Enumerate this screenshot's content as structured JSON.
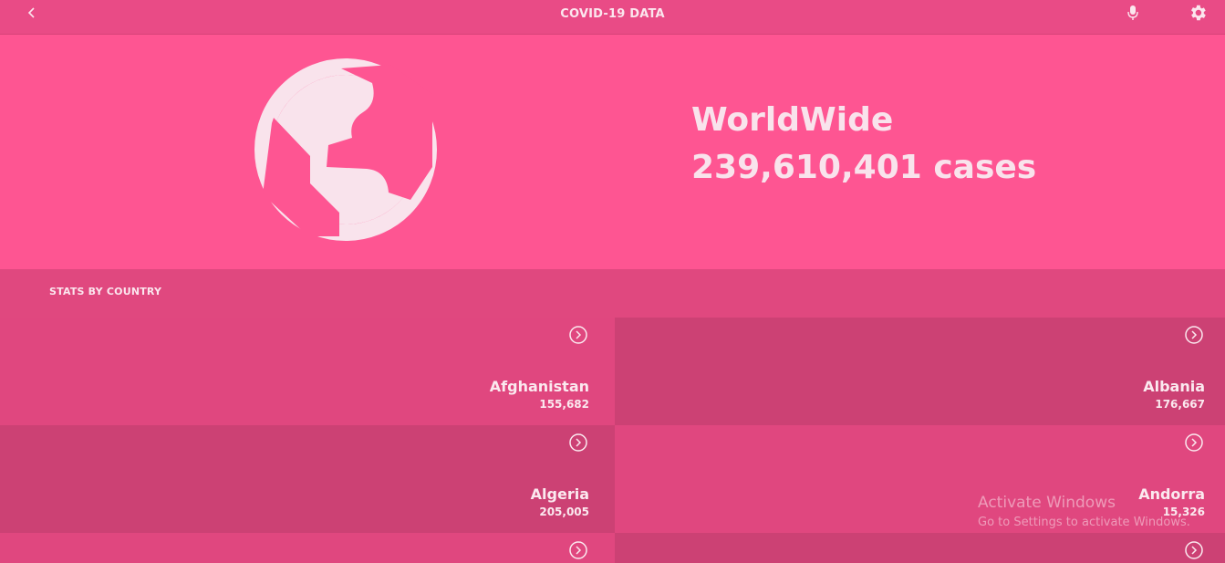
{
  "header": {
    "title": "COVID-19 DATA",
    "back_icon": "chevron-left-icon",
    "mic_icon": "microphone-icon",
    "settings_icon": "gear-icon"
  },
  "hero": {
    "label": "WorldWide",
    "cases_text": "239,610,401 cases",
    "icon": "globe-icon"
  },
  "section": {
    "label": "STATS BY COUNTRY"
  },
  "countries": [
    {
      "name": "Afghanistan",
      "cases": "155,682"
    },
    {
      "name": "Albania",
      "cases": "176,667"
    },
    {
      "name": "Algeria",
      "cases": "205,005"
    },
    {
      "name": "Andorra",
      "cases": "15,326"
    }
  ],
  "watermark": {
    "title": "Activate Windows",
    "subtitle": "Go to Settings to activate Windows."
  },
  "colors": {
    "header": "#e94b86",
    "hero": "#fe5592",
    "tile_light": "#e0477f",
    "tile_dark": "#cc4174",
    "text": "#fbe6ee"
  }
}
